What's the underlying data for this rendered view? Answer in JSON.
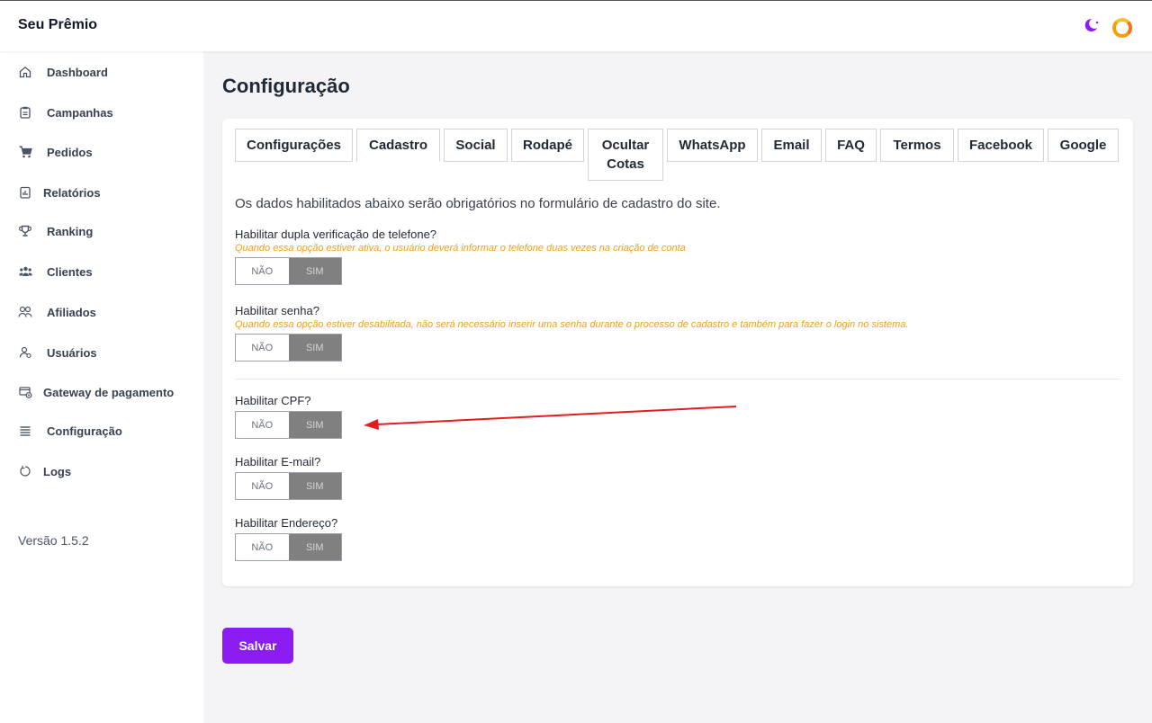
{
  "app": {
    "brand": "Seu Prêmio"
  },
  "sidebar": {
    "items": [
      {
        "label": "Dashboard",
        "icon": "home-icon"
      },
      {
        "label": "Campanhas",
        "icon": "clipboard-icon"
      },
      {
        "label": "Pedidos",
        "icon": "cart-icon"
      },
      {
        "label": "Relatórios",
        "icon": "report-icon"
      },
      {
        "label": "Ranking",
        "icon": "trophy-icon"
      },
      {
        "label": "Clientes",
        "icon": "users-icon"
      },
      {
        "label": "Afiliados",
        "icon": "affiliates-icon"
      },
      {
        "label": "Usuários",
        "icon": "user-icon"
      },
      {
        "label": "Gateway de pagamento",
        "icon": "payment-gateway-icon"
      },
      {
        "label": "Configuração",
        "icon": "list-icon"
      },
      {
        "label": "Logs",
        "icon": "refresh-icon"
      }
    ],
    "version": "Versão 1.5.2"
  },
  "page": {
    "title": "Configuração"
  },
  "tabs": [
    {
      "label": "Configurações",
      "active": false
    },
    {
      "label": "Cadastro",
      "active": true
    },
    {
      "label": "Social",
      "active": false
    },
    {
      "label": "Rodapé",
      "active": false
    },
    {
      "label": "Ocultar Cotas",
      "active": false
    },
    {
      "label": "WhatsApp",
      "active": false
    },
    {
      "label": "Email",
      "active": false
    },
    {
      "label": "FAQ",
      "active": false
    },
    {
      "label": "Termos",
      "active": false
    },
    {
      "label": "Facebook",
      "active": false
    },
    {
      "label": "Google",
      "active": false
    }
  ],
  "form": {
    "intro": "Os dados habilitados abaixo serão obrigatórios no formulário de cadastro do site.",
    "no_label": "NÃO",
    "yes_label": "SIM",
    "fields": [
      {
        "label": "Habilitar dupla verificação de telefone?",
        "hint": "Quando essa opção estiver ativa, o usuário deverá informar o telefone duas vezes na criação de conta",
        "value": "SIM"
      },
      {
        "label": "Habilitar senha?",
        "hint": "Quando essa opção estiver desabilitada, não será necessário inserir uma senha durante o processo de cadastro e também para fazer o login no sistema.",
        "value": "SIM"
      },
      {
        "label": "Habilitar CPF?",
        "hint": "",
        "value": "SIM"
      },
      {
        "label": "Habilitar E-mail?",
        "hint": "",
        "value": "SIM"
      },
      {
        "label": "Habilitar Endereço?",
        "hint": "",
        "value": "SIM"
      }
    ]
  },
  "actions": {
    "save_label": "Salvar"
  },
  "colors": {
    "accent": "#8b1cf2",
    "hint": "#f59e0b",
    "toggle_selected": "#808080",
    "annotation_arrow": "#e11d1d"
  }
}
